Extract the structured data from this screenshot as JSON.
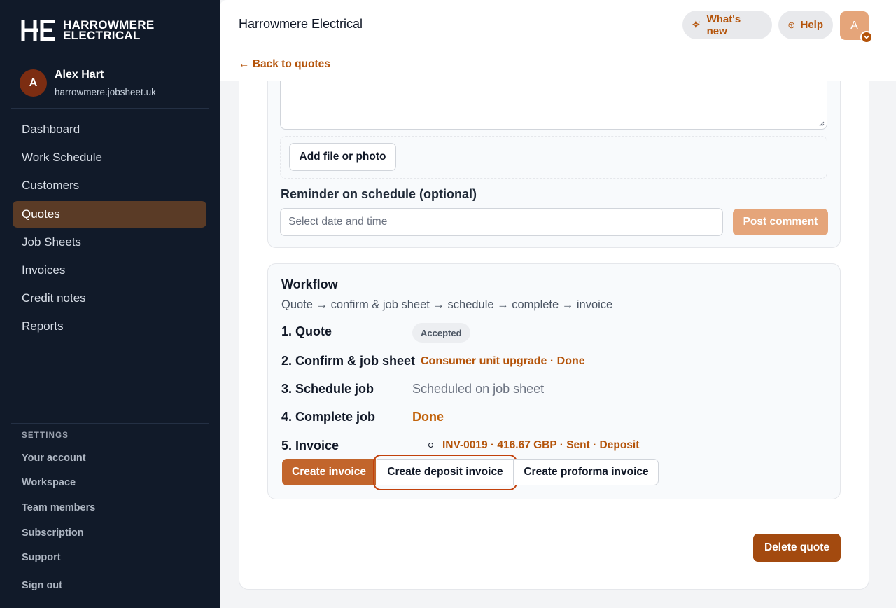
{
  "brand": {
    "logo_mark": "HE",
    "name_line1": "HARROWMERE",
    "name_line2": "ELECTRICAL"
  },
  "user": {
    "initial": "A",
    "name": "Alex Hart",
    "domain": "harrowmere.jobsheet.uk"
  },
  "nav": [
    {
      "label": "Dashboard",
      "active": false
    },
    {
      "label": "Work Schedule",
      "active": false
    },
    {
      "label": "Customers",
      "active": false
    },
    {
      "label": "Quotes",
      "active": true
    },
    {
      "label": "Job Sheets",
      "active": false
    },
    {
      "label": "Invoices",
      "active": false
    },
    {
      "label": "Credit notes",
      "active": false
    },
    {
      "label": "Reports",
      "active": false
    }
  ],
  "settings": {
    "title": "SETTINGS",
    "items": [
      "Your account",
      "Workspace",
      "Team members",
      "Subscription",
      "Support"
    ],
    "sign_out": "Sign out"
  },
  "header": {
    "title": "Harrowmere Electrical",
    "whats_new": "What's new",
    "help": "Help",
    "avatar_initial": "A",
    "back_link": "← Back to quotes"
  },
  "comment": {
    "add_file": "Add file or photo",
    "reminder_label": "Reminder on schedule (optional)",
    "date_placeholder": "Select date and time",
    "post_button": "Post comment"
  },
  "workflow": {
    "title": "Workflow",
    "subtitle": "Quote → confirm & job sheet → schedule → complete → invoice",
    "steps": {
      "quote": {
        "label": "1. Quote",
        "status": "Accepted"
      },
      "confirm": {
        "label": "2. Confirm & job sheet",
        "link": "Consumer unit upgrade · Done"
      },
      "schedule": {
        "label": "3. Schedule job",
        "status": "Scheduled on job sheet"
      },
      "complete": {
        "label": "4. Complete job",
        "status": "Done"
      },
      "invoice": {
        "label": "5. Invoice",
        "link": "INV-0019 · 416.67 GBP · Sent · Deposit"
      }
    },
    "buttons": {
      "create": "Create invoice",
      "deposit": "Create deposit invoice",
      "proforma": "Create proforma invoice"
    }
  },
  "delete_button": "Delete quote",
  "colors": {
    "sidebar_bg": "#111a29",
    "accent": "#b45309",
    "primary_button": "#c2652c",
    "delete_button": "#a34a0f"
  }
}
